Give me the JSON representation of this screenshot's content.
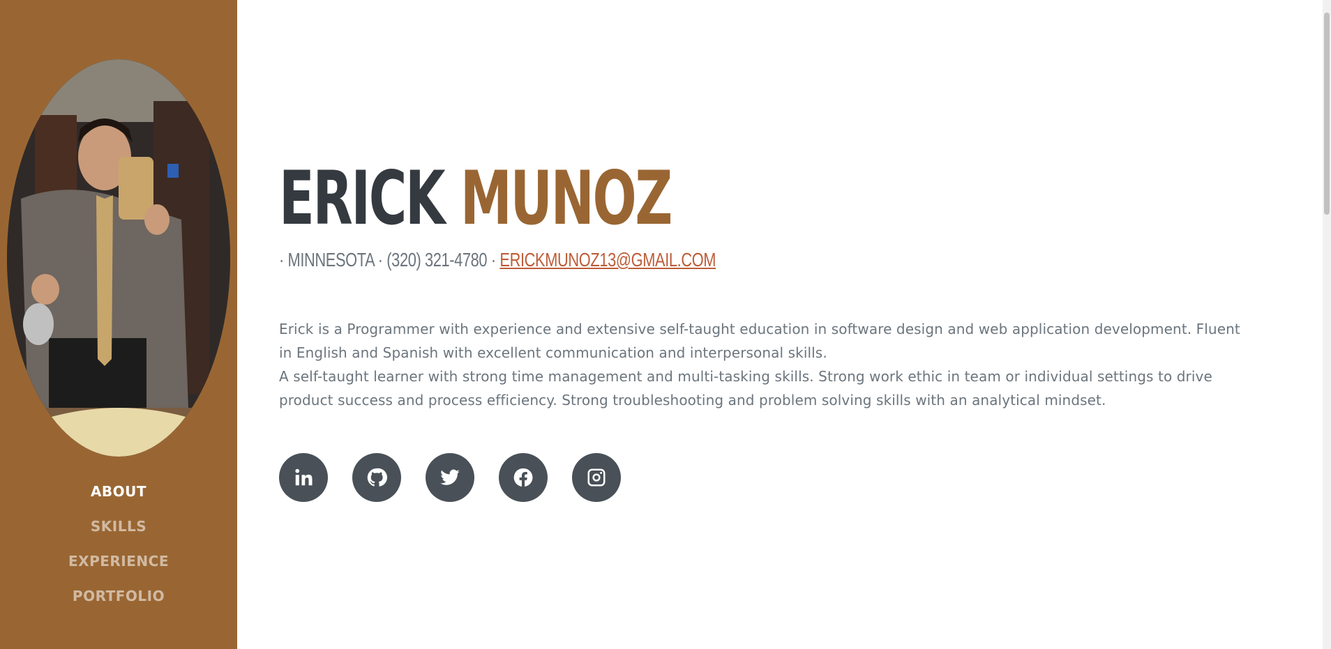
{
  "sidebar": {
    "avatar_alt": "profile photo",
    "nav": [
      {
        "label": "ABOUT",
        "active": true
      },
      {
        "label": "SKILLS",
        "active": false
      },
      {
        "label": "EXPERIENCE",
        "active": false
      },
      {
        "label": "PORTFOLIO",
        "active": false
      }
    ]
  },
  "header": {
    "first_name": "ERICK",
    "last_name": "MUNOZ",
    "subheading_prefix": "· MINNESOTA · (320) 321-4780 · ",
    "email": "ERICKMUNOZ13@GMAIL.COM"
  },
  "bio": {
    "line1": "Erick is a Programmer with experience and extensive self-taught education in software design and web application development. Fluent in English and Spanish with excellent communication and interpersonal skills.",
    "line2": "A self-taught learner with strong time management and multi-tasking skills. Strong work ethic in team or individual settings to drive product success and process efficiency. Strong troubleshooting and problem solving skills with an analytical mindset."
  },
  "socials": [
    {
      "icon": "linkedin-icon"
    },
    {
      "icon": "github-icon"
    },
    {
      "icon": "twitter-icon"
    },
    {
      "icon": "facebook-icon"
    },
    {
      "icon": "instagram-icon"
    }
  ],
  "colors": {
    "brand": "#996633",
    "dark": "#343a40",
    "text": "#6c757d",
    "link": "#bd5d38",
    "social_bg": "#495057"
  }
}
